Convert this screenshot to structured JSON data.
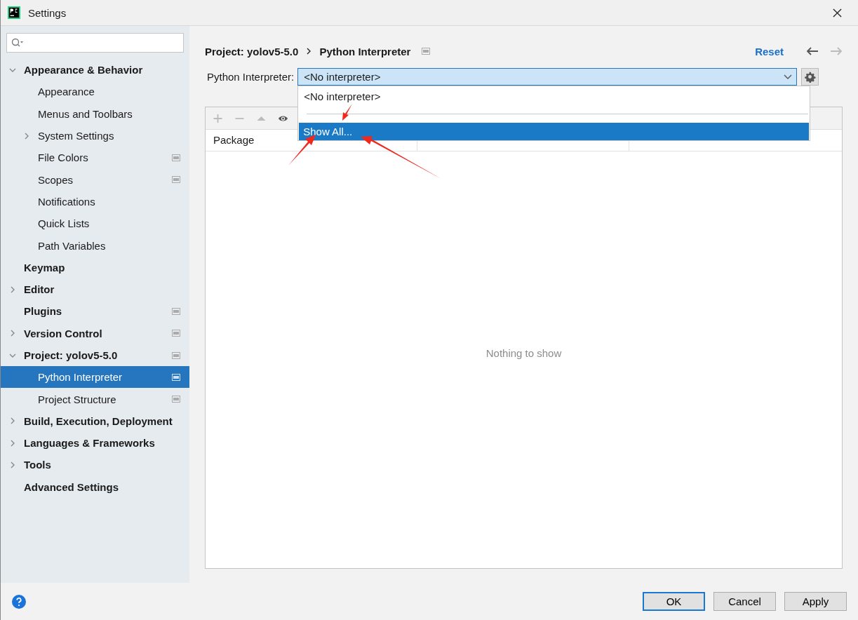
{
  "window": {
    "title": "Settings"
  },
  "sidebar": {
    "items": [
      {
        "label": "Appearance & Behavior",
        "expanded": true,
        "scoped": false,
        "selected": false,
        "children": [
          {
            "label": "Appearance",
            "scoped": false,
            "selected": false
          },
          {
            "label": "Menus and Toolbars",
            "scoped": false,
            "selected": false
          },
          {
            "label": "System Settings",
            "expanded": false,
            "scoped": false,
            "selected": false
          },
          {
            "label": "File Colors",
            "scoped": true,
            "selected": false
          },
          {
            "label": "Scopes",
            "scoped": true,
            "selected": false
          },
          {
            "label": "Notifications",
            "scoped": false,
            "selected": false
          },
          {
            "label": "Quick Lists",
            "scoped": false,
            "selected": false
          },
          {
            "label": "Path Variables",
            "scoped": false,
            "selected": false
          }
        ]
      },
      {
        "label": "Keymap",
        "scoped": false,
        "selected": false
      },
      {
        "label": "Editor",
        "expanded": false,
        "scoped": false,
        "selected": false
      },
      {
        "label": "Plugins",
        "scoped": true,
        "selected": false
      },
      {
        "label": "Version Control",
        "expanded": false,
        "scoped": true,
        "selected": false
      },
      {
        "label": "Project: yolov5-5.0",
        "expanded": true,
        "scoped": true,
        "selected": false,
        "children": [
          {
            "label": "Python Interpreter",
            "scoped": true,
            "selected": true
          },
          {
            "label": "Project Structure",
            "scoped": true,
            "selected": false
          }
        ]
      },
      {
        "label": "Build, Execution, Deployment",
        "expanded": false,
        "scoped": false,
        "selected": false
      },
      {
        "label": "Languages & Frameworks",
        "expanded": false,
        "scoped": false,
        "selected": false
      },
      {
        "label": "Tools",
        "expanded": false,
        "scoped": false,
        "selected": false
      },
      {
        "label": "Advanced Settings",
        "scoped": false,
        "selected": false
      }
    ]
  },
  "breadcrumb": [
    "Project: yolov5-5.0",
    "Python Interpreter"
  ],
  "reset": "Reset",
  "interpreter": {
    "label": "Python Interpreter:",
    "value": "<No interpreter>"
  },
  "dropdown": {
    "items": [
      {
        "kind": "option",
        "label": "<No interpreter>",
        "selected": false
      },
      {
        "kind": "separator"
      },
      {
        "kind": "option",
        "label": "Show All...",
        "selected": true
      }
    ]
  },
  "packages": {
    "columns": [
      "Package"
    ],
    "empty_text": "Nothing to show"
  },
  "buttons": [
    {
      "label": "OK",
      "default": true
    },
    {
      "label": "Cancel",
      "default": false
    },
    {
      "label": "Apply",
      "default": false
    }
  ]
}
